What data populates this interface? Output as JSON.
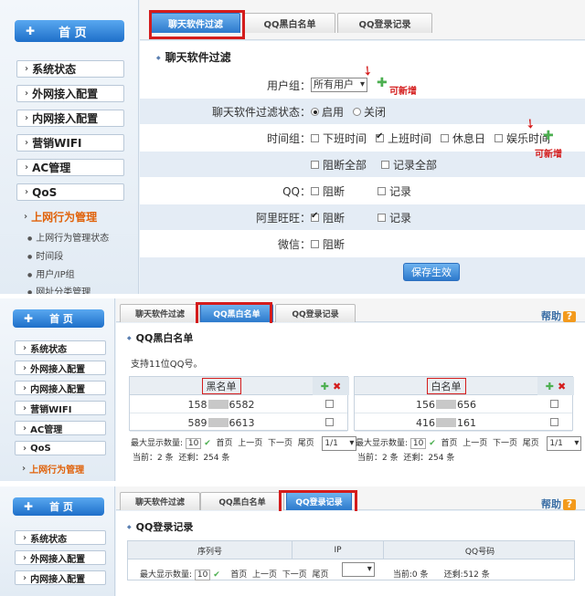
{
  "sidebar": {
    "home": "首 页",
    "items": [
      "系统状态",
      "外网接入配置",
      "内网接入配置",
      "营销WIFI",
      "AC管理",
      "QoS",
      "上网行为管理"
    ],
    "subitems": [
      "上网行为管理状态",
      "时间段",
      "用户/IP组",
      "网址分类管理"
    ]
  },
  "tabs": [
    "聊天软件过滤",
    "QQ黑白名单",
    "QQ登录记录"
  ],
  "help": "帮助",
  "p1": {
    "title": "聊天软件过滤",
    "user_group_label": "用户组：",
    "user_group_value": "所有用户",
    "new_note": "可新增",
    "status_label": "聊天软件过滤状态：",
    "enable": "启用",
    "disable": "关闭",
    "time_group_label": "时间组：",
    "time_options": [
      "下班时间",
      "上班时间",
      "休息日",
      "娱乐时间"
    ],
    "block_all": "阻断全部",
    "record_all": "记录全部",
    "apps": [
      {
        "label": "QQ：",
        "block": "阻断",
        "record": "记录"
      },
      {
        "label": "阿里旺旺：",
        "block": "阻断",
        "record": "记录"
      },
      {
        "label": "微信：",
        "block": "阻断"
      }
    ],
    "save": "保存生效"
  },
  "p2": {
    "title": "QQ黑白名单",
    "hint": "支持11位QQ号。",
    "black": {
      "header": "黑名单",
      "rows": [
        [
          "158",
          "6582"
        ],
        [
          "589",
          "6613"
        ]
      ]
    },
    "white": {
      "header": "白名单",
      "rows": [
        [
          "156",
          "656"
        ],
        [
          "416",
          "161"
        ]
      ]
    },
    "pager": {
      "max_label": "最大显示数量:",
      "max_value": "10",
      "first": "首页",
      "prev": "上一页",
      "next": "下一页",
      "last": "尾页",
      "page": "1/1",
      "current": "当前：2 条",
      "remaining": "还剩：254 条"
    }
  },
  "p3": {
    "title": "QQ登录记录",
    "cols": [
      "序列号",
      "IP",
      "QQ号码"
    ],
    "pager": {
      "max_label": "最大显示数量:",
      "max_value": "10",
      "first": "首页",
      "prev": "上一页",
      "next": "下一页",
      "last": "尾页",
      "current": "当前:0 条",
      "remaining": "还剩:512 条"
    }
  }
}
